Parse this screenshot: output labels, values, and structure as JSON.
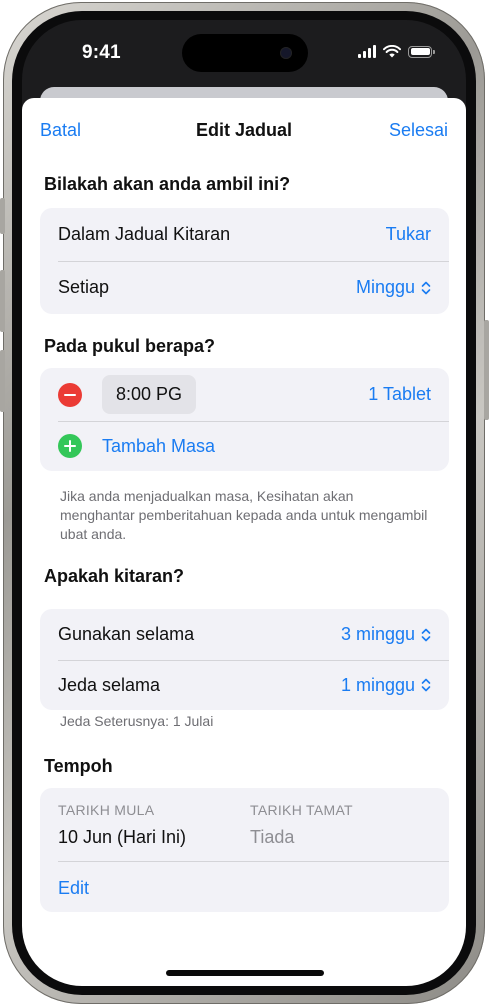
{
  "status_bar": {
    "time": "9:41",
    "icons": [
      "signal-icon",
      "wifi-icon",
      "battery-icon"
    ]
  },
  "nav": {
    "cancel_label": "Batal",
    "title": "Edit Jadual",
    "done_label": "Selesai"
  },
  "when_section": {
    "header": "Bilakah akan anda ambil ini?",
    "rows": [
      {
        "label": "Dalam Jadual Kitaran",
        "value": "Tukar"
      },
      {
        "label": "Setiap",
        "value": "Minggu"
      }
    ]
  },
  "time_section": {
    "header": "Pada pukul berapa?",
    "entry": {
      "time": "8:00 PG",
      "dose": "1 Tablet"
    },
    "add_label": "Tambah Masa",
    "footnote": "Jika anda menjadualkan masa, Kesihatan akan menghantar pemberitahuan kepada anda untuk mengambil ubat anda."
  },
  "cycle_section": {
    "header": "Apakah kitaran?",
    "rows": [
      {
        "label": "Gunakan selama",
        "value": "3 minggu"
      },
      {
        "label": "Jeda selama",
        "value": "1 minggu"
      }
    ],
    "footnote": "Jeda Seterusnya: 1 Julai"
  },
  "duration_section": {
    "header": "Tempoh",
    "start_label": "TARIKH MULA",
    "start_value": "10 Jun (Hari Ini)",
    "end_label": "TARIKH TAMAT",
    "end_value": "Tiada",
    "edit_label": "Edit"
  },
  "colors": {
    "accent": "#1a7cf2",
    "remove": "#eb3b35",
    "add": "#34c759",
    "group_background": "#f2f2f7"
  }
}
